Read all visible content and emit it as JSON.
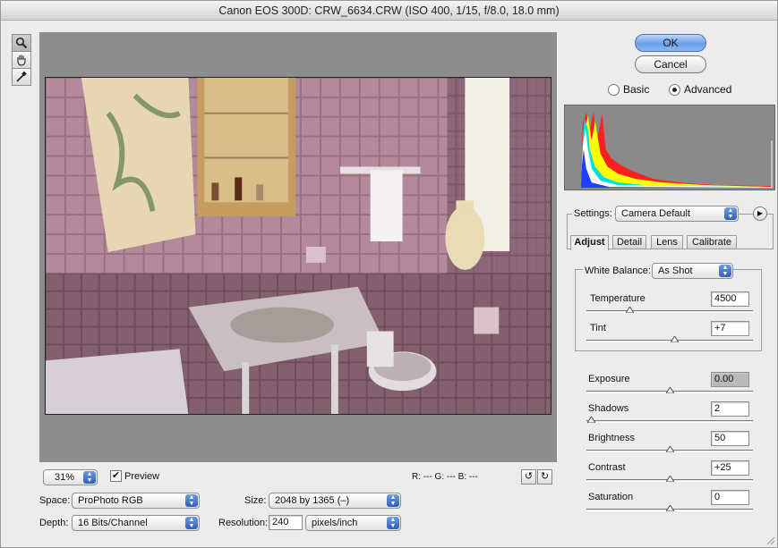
{
  "window": {
    "title": "Canon EOS 300D:  CRW_6634.CRW  (ISO 400, 1/15, f/8.0, 18.0 mm)"
  },
  "tools": [
    {
      "name": "zoom-tool",
      "icon": "magnifier-icon"
    },
    {
      "name": "hand-tool",
      "icon": "hand-icon"
    },
    {
      "name": "white-balance-tool",
      "icon": "eyedropper-icon"
    }
  ],
  "bottom_bar": {
    "zoom": "31%",
    "preview_label": "Preview",
    "preview_checked": true,
    "rgb_readout": "R:  ---   G:  ---   B:  ---",
    "rotate_left_icon": "rotate-ccw-icon",
    "rotate_right_icon": "rotate-cw-icon"
  },
  "workflow": {
    "space_label": "Space:",
    "space_value": "ProPhoto RGB",
    "depth_label": "Depth:",
    "depth_value": "16 Bits/Channel",
    "size_label": "Size:",
    "size_value": "2048 by 1365  (–)",
    "resolution_label": "Resolution:",
    "resolution_value": "240",
    "resolution_units": "pixels/inch"
  },
  "buttons": {
    "ok": "OK",
    "cancel": "Cancel"
  },
  "mode": {
    "basic": "Basic",
    "advanced": "Advanced",
    "selected": "advanced"
  },
  "settings": {
    "label": "Settings:",
    "value": "Camera Default"
  },
  "tabs": [
    {
      "label": "Adjust",
      "active": true
    },
    {
      "label": "Detail",
      "active": false
    },
    {
      "label": "Lens",
      "active": false
    },
    {
      "label": "Calibrate",
      "active": false
    }
  ],
  "white_balance": {
    "label": "White Balance:",
    "value": "As Shot"
  },
  "sliders": {
    "temperature": {
      "label": "Temperature",
      "value": "4500",
      "fraction": 0.26
    },
    "tint": {
      "label": "Tint",
      "value": "+7",
      "fraction": 0.53
    },
    "exposure": {
      "label": "Exposure",
      "value": "0.00",
      "fraction": 0.5
    },
    "shadows": {
      "label": "Shadows",
      "value": "2",
      "fraction": 0.03
    },
    "brightness": {
      "label": "Brightness",
      "value": "50",
      "fraction": 0.5
    },
    "contrast": {
      "label": "Contrast",
      "value": "+25",
      "fraction": 0.5
    },
    "saturation": {
      "label": "Saturation",
      "value": "0",
      "fraction": 0.5
    }
  }
}
